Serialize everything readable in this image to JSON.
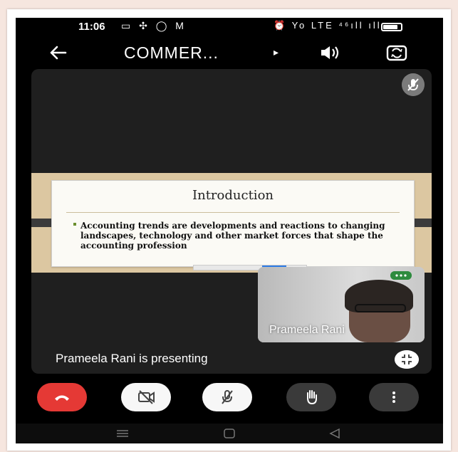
{
  "status_bar": {
    "time": "11:06",
    "left_icons": "▭ ✣ ◯ M",
    "right_icons": "⏰ Yo LTE ⁴⁶ıll ıll"
  },
  "app_bar": {
    "title": "COMMER...",
    "play_glyph": "▸"
  },
  "slide": {
    "title": "Introduction",
    "body": "Accounting trends are developments and reactions to changing landscapes, technology and other market forces that shape the accounting profession"
  },
  "self_view": {
    "name": "Prameela Rani"
  },
  "presenting": {
    "text": "Prameela Rani is presenting"
  },
  "colors": {
    "end_call": "#e53935",
    "tile_dots": "#2e8b3e",
    "slide_frame": "#dcc7a1"
  }
}
